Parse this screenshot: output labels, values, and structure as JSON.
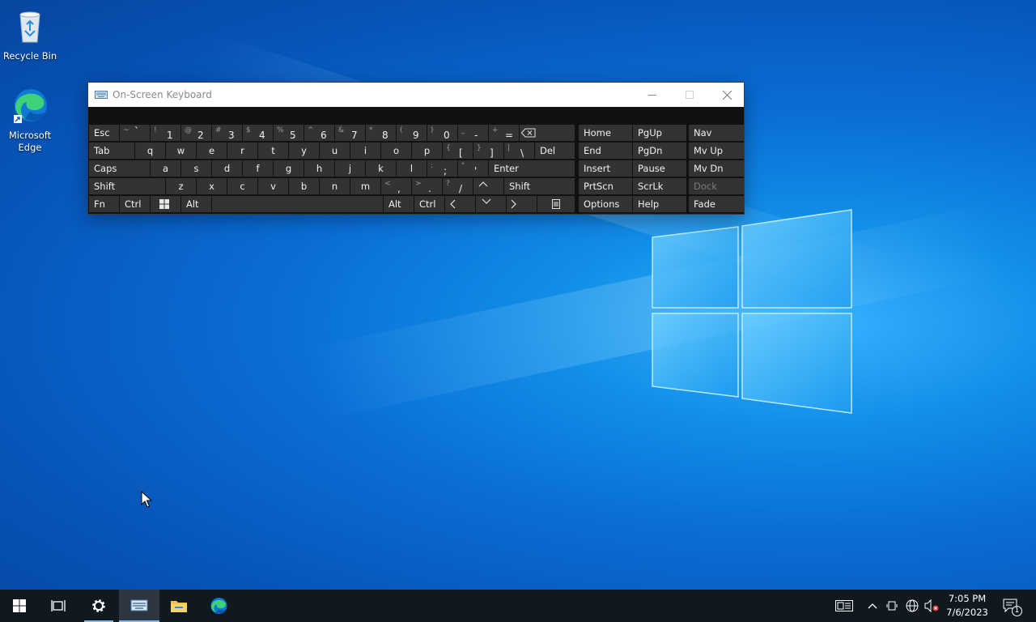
{
  "desktop": {
    "icons": [
      {
        "label": "Recycle Bin",
        "icon": "recycle-bin-icon"
      },
      {
        "label": "Microsoft Edge",
        "icon": "edge-icon"
      }
    ]
  },
  "osk": {
    "title": "On-Screen Keyboard",
    "keys": {
      "esc": "Esc",
      "tab": "Tab",
      "caps": "Caps",
      "shift_left": "Shift",
      "fn": "Fn",
      "ctrl_left": "Ctrl",
      "alt_left": "Alt",
      "alt_right": "Alt",
      "ctrl_right": "Ctrl",
      "del": "Del",
      "enter": "Enter",
      "shift_right": "Shift",
      "num": [
        {
          "shift": "~",
          "main": "`"
        },
        {
          "shift": "!",
          "main": "1"
        },
        {
          "shift": "@",
          "main": "2"
        },
        {
          "shift": "#",
          "main": "3"
        },
        {
          "shift": "$",
          "main": "4"
        },
        {
          "shift": "%",
          "main": "5"
        },
        {
          "shift": "^",
          "main": "6"
        },
        {
          "shift": "&",
          "main": "7"
        },
        {
          "shift": "*",
          "main": "8"
        },
        {
          "shift": "(",
          "main": "9"
        },
        {
          "shift": ")",
          "main": "0"
        },
        {
          "shift": "_",
          "main": "-"
        },
        {
          "shift": "+",
          "main": "="
        }
      ],
      "row_q": [
        "q",
        "w",
        "e",
        "r",
        "t",
        "y",
        "u",
        "i",
        "o",
        "p"
      ],
      "row_q_sym": [
        {
          "shift": "{",
          "main": "["
        },
        {
          "shift": "}",
          "main": "]"
        },
        {
          "shift": "|",
          "main": "\\"
        }
      ],
      "row_a": [
        "a",
        "s",
        "d",
        "f",
        "g",
        "h",
        "j",
        "k",
        "l"
      ],
      "row_a_sym": [
        {
          "shift": ":",
          "main": ";"
        },
        {
          "shift": "\"",
          "main": "'"
        }
      ],
      "row_z": [
        "z",
        "x",
        "c",
        "v",
        "b",
        "n",
        "m"
      ],
      "row_z_sym": [
        {
          "shift": "<",
          "main": ","
        },
        {
          "shift": ">",
          "main": "."
        },
        {
          "shift": "?",
          "main": "/"
        }
      ]
    },
    "nav": {
      "home": "Home",
      "pgup": "PgUp",
      "nav": "Nav",
      "end": "End",
      "pgdn": "PgDn",
      "mvup": "Mv Up",
      "insert": "Insert",
      "pause": "Pause",
      "mvdn": "Mv Dn",
      "prtscn": "PrtScn",
      "scrlk": "ScrLk",
      "dock": "Dock",
      "options": "Options",
      "help": "Help",
      "fade": "Fade"
    }
  },
  "taskbar": {
    "clock_time": "7:05 PM",
    "clock_date": "7/6/2023",
    "notification_count": "1"
  },
  "colors": {
    "taskbar": "#101820",
    "key": "#333334",
    "accent": "#7bb8ef"
  }
}
